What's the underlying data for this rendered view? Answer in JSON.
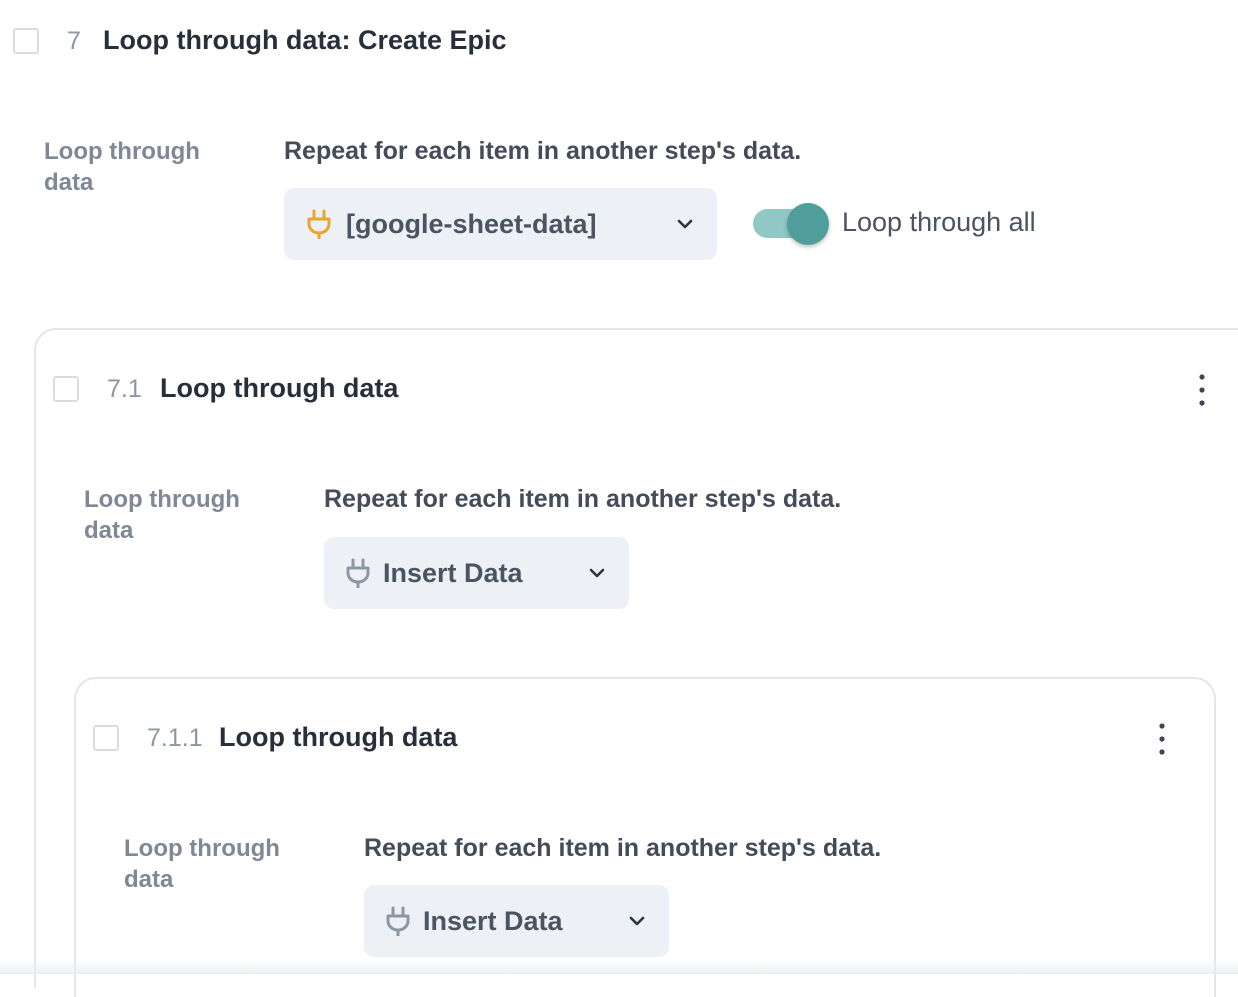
{
  "step7": {
    "number": "7",
    "title": "Loop through data: Create Epic",
    "side_label": "Loop through data",
    "description": "Repeat for each item in another step's data.",
    "select_value": "[google-sheet-data]",
    "select_icon": "plug-icon",
    "select_icon_color": "#e8a530",
    "toggle_on": true,
    "toggle_label": "Loop through all",
    "toggle_color": "#4f9e9c"
  },
  "step7_1": {
    "number": "7.1",
    "title": "Loop through data",
    "side_label": "Loop through data",
    "description": "Repeat for each item in another step's data.",
    "select_value": "Insert Data",
    "select_icon": "plug-icon",
    "select_icon_color": "#8d97a3",
    "menu_icon": "kebab-menu-icon"
  },
  "step7_1_1": {
    "number": "7.1.1",
    "title": "Loop through data",
    "side_label": "Loop through data",
    "description": "Repeat for each item in another step's data.",
    "select_value": "Insert Data",
    "select_icon": "plug-icon",
    "select_icon_color": "#8d97a3",
    "menu_icon": "kebab-menu-icon"
  }
}
